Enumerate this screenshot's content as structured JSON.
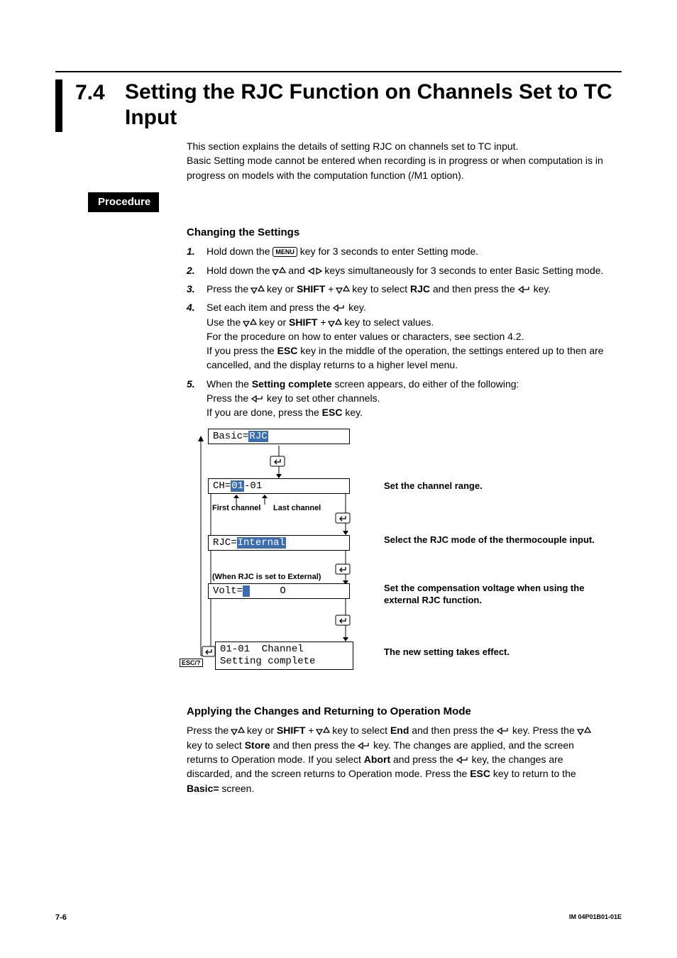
{
  "section": {
    "number": "7.4",
    "title": "Setting the RJC Function on Channels Set to TC Input"
  },
  "intro": [
    "This section explains the details of setting RJC on channels set to TC input.",
    "Basic Setting mode cannot be entered when recording is in progress or when computation is in progress on models with the computation function (/M1 option)."
  ],
  "procedure_label": "Procedure",
  "sub1_heading": "Changing the Settings",
  "steps": [
    {
      "n": "1.",
      "pre": "Hold down the ",
      "key": "MENU",
      "post": " key for 3 seconds to enter Setting mode."
    },
    {
      "n": "2.",
      "html": "Hold down the {UPDN} and {LEFTRIGHT} keys simultaneously for 3 seconds to enter Basic Setting mode."
    },
    {
      "n": "3.",
      "html": "Press the {UPDN} key or <b>SHIFT</b> + {UPDN} key to select <b>RJC</b> and then press the {ENTER} key."
    },
    {
      "n": "4.",
      "lines": [
        "Set each item and press the {ENTER} key.",
        "Use the {UPDN} key or <b>SHIFT</b> + {UPDN} key to select values.",
        "For the procedure on how to enter values or characters, see section 4.2.",
        "If you press the <b>ESC</b> key in the middle of the operation, the settings entered up to then are cancelled, and the display returns to a higher level menu."
      ]
    },
    {
      "n": "5.",
      "lines": [
        "When the <b>Setting complete</b> screen appears, do either of the following:",
        "Press the {ENTER} key to set other channels.",
        "If you are done, press the <b>ESC</b> key."
      ]
    }
  ],
  "diagram": {
    "box1_pre": "Basic=",
    "box1_hl": "RJC",
    "box2_pre": "CH=",
    "box2_hl": "01",
    "box2_post": "-01",
    "box2_lbl_first": "First channel",
    "box2_lbl_last": "Last channel",
    "box3_pre": "RJC=",
    "box3_hl": "Internal",
    "box3_lbl_when": "(When RJC is set to External)",
    "box4_pre": "Volt=",
    "box4_hl": " ",
    "box4_post": "     O",
    "box5a": "01-01  Channel",
    "box5b": "Setting complete",
    "esc_lbl": "ESC/?",
    "side1": "Set the channel range.",
    "side2": "Select the RJC mode of the thermocouple input.",
    "side3": "Set the compensation voltage when using the external RJC function.",
    "side4": "The new setting takes effect."
  },
  "sub2_heading": "Applying the Changes and Returning to Operation Mode",
  "apply_para_html": "Press the {UPDN} key or <b>SHIFT</b> + {UPDN} key to select <b>End</b> and then press the {ENTER} key. Press the {UPDN} key to select <b>Store</b> and then press the {ENTER} key. The changes are applied, and the screen returns to Operation mode. If you select <b>Abort</b> and press the {ENTER} key, the changes are discarded, and the screen returns to Operation mode. Press the <b>ESC</b> key to return to the <b>Basic=</b> screen.",
  "footer": {
    "page": "7-6",
    "doc": "IM 04P01B01-01E"
  }
}
